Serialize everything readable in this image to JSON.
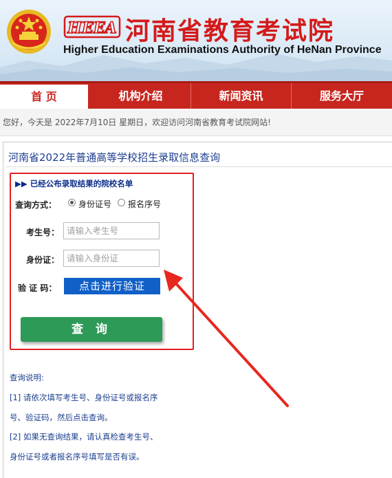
{
  "header": {
    "logo_text": "HEEA",
    "org_name_cn": "河南省教育考试院",
    "org_name_en": "Higher Education Examinations Authority of HeNan Province",
    "emblem_icon": "national-emblem-icon"
  },
  "nav": {
    "items": [
      "首 页",
      "机构介绍",
      "新闻资讯",
      "服务大厅"
    ],
    "active_index": 0
  },
  "welcome_text": "您好，今天是 2022年7月10日 星期日，欢迎访问河南省教育考试院网站!",
  "panel": {
    "title": "河南省2022年普通高等学校招生录取信息查询"
  },
  "form": {
    "published_link": "▶▶ 已经公布录取结果的院校名单",
    "query_method_label": "查询方式：",
    "radio_options": [
      "身份证号",
      "报名序号"
    ],
    "selected_option": "身份证号",
    "exam_no_label": "考生号：",
    "exam_no_placeholder": "请输入考生号",
    "id_label": "身份证：",
    "id_placeholder": "请输入身份证",
    "captcha_label": "验 证 码：",
    "verify_button": "点击进行验证",
    "query_button": "查 询"
  },
  "notes": {
    "title": "查询说明:",
    "lines": [
      "[1] 请依次填写考生号、身份证号或报名序",
      "号、验证码，然后点击查询。",
      "[2] 如果无查询结果，请认真检查考生号、",
      "身份证号或者报名序号填写是否有误。"
    ]
  },
  "colors": {
    "brand_red": "#c7261e",
    "link_blue": "#1c3f8f",
    "verify_blue": "#1060c8",
    "query_green": "#2e9a58",
    "highlight_red": "#e02020"
  }
}
